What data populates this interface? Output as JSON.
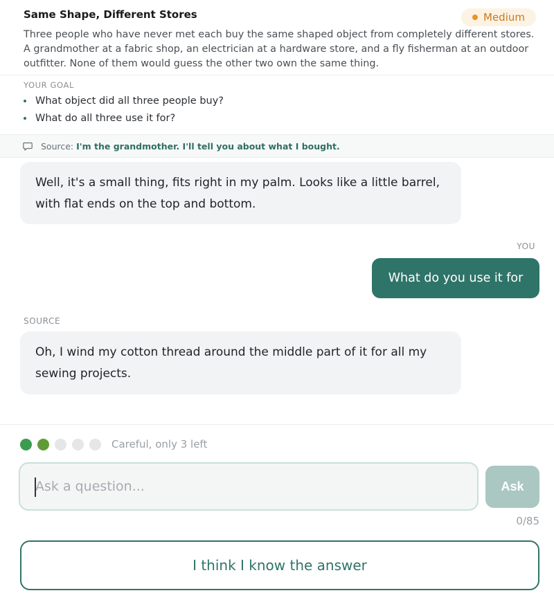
{
  "puzzle": {
    "title": "Same Shape, Different Stores",
    "difficulty": "Medium",
    "description": "Three people who have never met each buy the same shaped object from completely different stores. A grandmother at a fabric shop, an electrician at a hardware store, and a fly fisherman at an outdoor outfitter. None of them would guess the other two own the same thing."
  },
  "goal": {
    "label": "YOUR GOAL",
    "items": [
      "What object did all three people buy?",
      "What do all three use it for?"
    ]
  },
  "source": {
    "prefix": "Source:",
    "quote": "I'm the grandmother. I'll tell you about what I bought."
  },
  "chat": {
    "messages": [
      {
        "role": "source",
        "text": "Well, it's a small thing, fits right in my palm. Looks like a little barrel, with flat ends on the top and bottom."
      },
      {
        "role": "you",
        "label": "YOU",
        "text": "What do you use it for"
      },
      {
        "role": "source",
        "label": "SOURCE",
        "text": "Oh, I wind my cotton thread around the middle part of it for all my sewing projects."
      }
    ]
  },
  "questions": {
    "total": 5,
    "used": 2,
    "note": "Careful, only 3 left",
    "dot_colors": [
      "#3b9b4f",
      "#5e9d35",
      "#e4e6e8",
      "#e4e6e8",
      "#e4e6e8"
    ]
  },
  "input": {
    "placeholder": "Ask a question...",
    "value": "",
    "counter": "0/85",
    "ask_label": "Ask"
  },
  "answer_button": "I think I know the answer",
  "colors": {
    "accent": "#2f7468",
    "badge_bg": "#fdf3e4",
    "badge_text": "#c77a1e"
  }
}
